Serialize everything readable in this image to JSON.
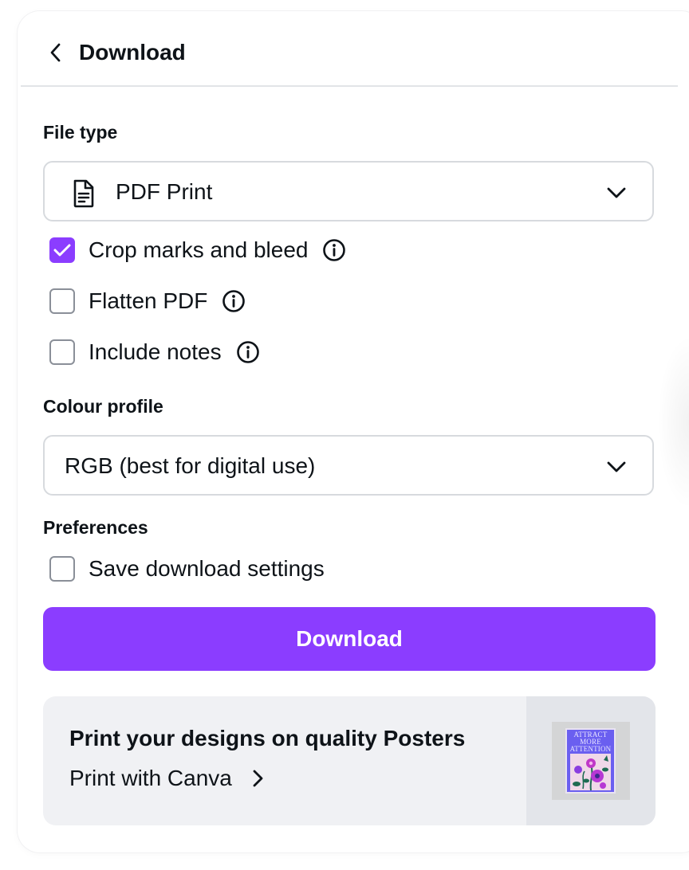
{
  "header": {
    "title": "Download"
  },
  "file_type": {
    "label": "File type",
    "selected": "PDF Print",
    "icon": "document-icon"
  },
  "options": [
    {
      "label": "Crop marks and bleed",
      "checked": true
    },
    {
      "label": "Flatten PDF",
      "checked": false
    },
    {
      "label": "Include notes",
      "checked": false
    }
  ],
  "colour_profile": {
    "label": "Colour profile",
    "selected": "RGB (best for digital use)"
  },
  "preferences": {
    "label": "Preferences",
    "save_settings_label": "Save download settings",
    "save_settings_checked": false
  },
  "download_button": "Download",
  "promo": {
    "title": "Print your designs on quality Posters",
    "link": "Print with Canva",
    "poster_text": "ATTRACT MORE ATTENTION"
  },
  "colors": {
    "accent": "#8b3dff",
    "text": "#0e1318",
    "border": "#d7dade"
  }
}
